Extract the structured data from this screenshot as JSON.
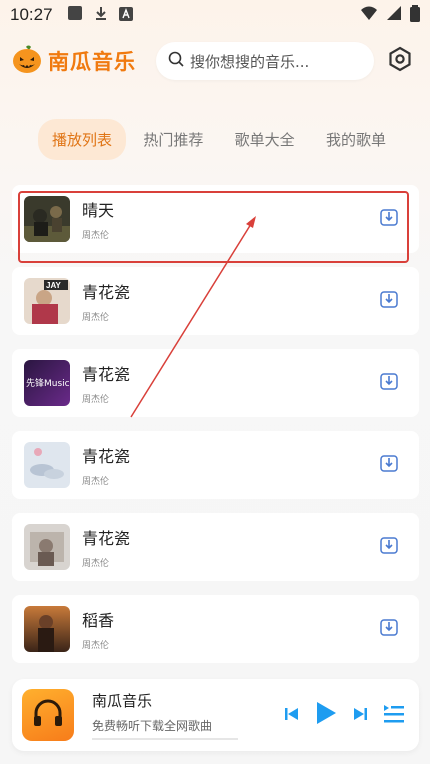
{
  "status_bar": {
    "time": "10:27",
    "icons": [
      "stop-icon",
      "download-icon",
      "a-icon",
      "wifi-icon",
      "signal-icon",
      "battery-icon"
    ]
  },
  "header": {
    "app_name": "南瓜音乐",
    "search_placeholder": "搜你想搜的音乐...",
    "icons": [
      "pumpkin-logo-icon",
      "search-icon",
      "settings-icon"
    ]
  },
  "tabs": [
    {
      "label": "播放列表",
      "active": true
    },
    {
      "label": "热门推荐",
      "active": false
    },
    {
      "label": "歌单大全",
      "active": false
    },
    {
      "label": "我的歌单",
      "active": false
    }
  ],
  "songs": [
    {
      "title": "晴天",
      "artist": "周杰伦",
      "highlighted": true
    },
    {
      "title": "青花瓷",
      "artist": "周杰伦"
    },
    {
      "title": "青花瓷",
      "artist": "周杰伦"
    },
    {
      "title": "青花瓷",
      "artist": "周杰伦"
    },
    {
      "title": "青花瓷",
      "artist": "周杰伦"
    },
    {
      "title": "稻香",
      "artist": "周杰伦"
    }
  ],
  "thumb_text": {
    "song_1": "JAY",
    "song_2": "先锋Music"
  },
  "player": {
    "title": "南瓜音乐",
    "subtitle": "免费畅听下载全网歌曲",
    "icons": [
      "headphones-icon",
      "previous-icon",
      "play-icon",
      "next-icon",
      "playlist-icon"
    ]
  },
  "colors": {
    "accent": "#f07a10",
    "tab_active_bg": "#fde8d4",
    "player_accent": "#1e9cf0",
    "annotation": "#d9403a"
  }
}
